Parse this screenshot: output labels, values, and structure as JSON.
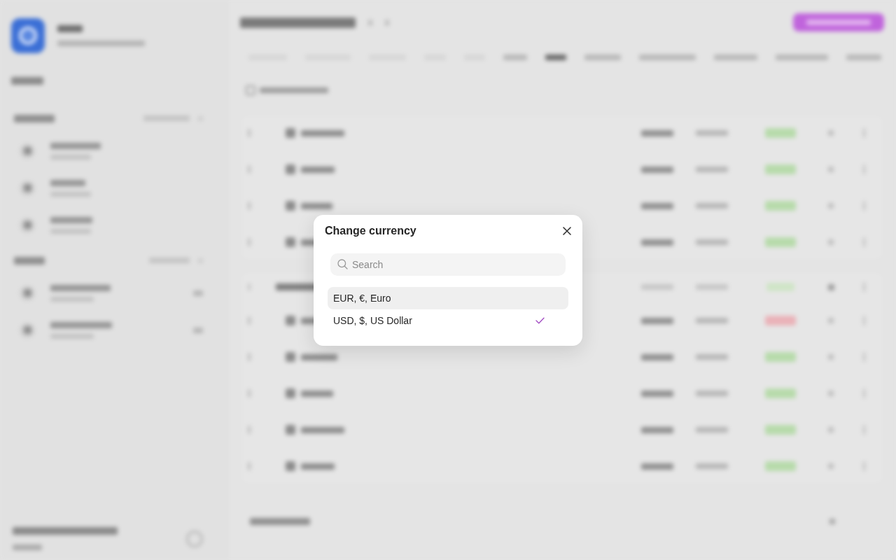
{
  "dialog": {
    "title": "Change currency",
    "search": {
      "placeholder": "Search"
    },
    "currencies": [
      {
        "label": "EUR, €, Euro",
        "selected": false,
        "highlighted": true
      },
      {
        "label": "USD, $, US Dollar",
        "selected": true,
        "highlighted": false
      }
    ]
  }
}
